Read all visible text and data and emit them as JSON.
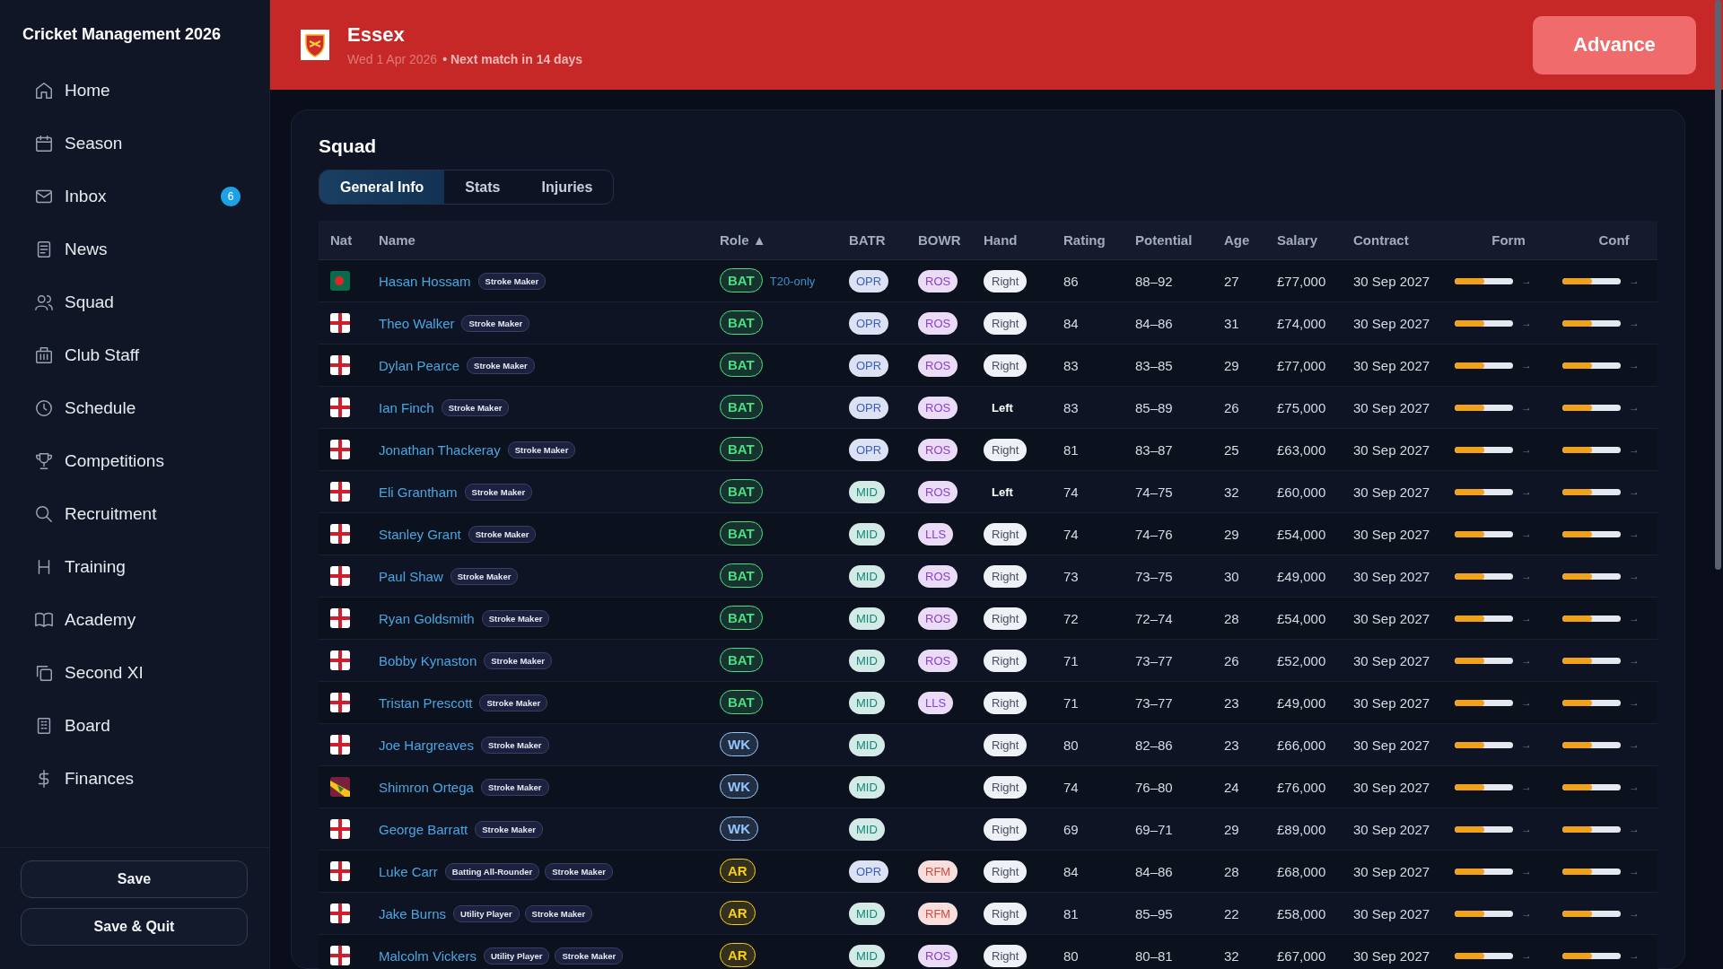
{
  "app_title": "Cricket Management 2026",
  "nav": [
    {
      "label": "Home"
    },
    {
      "label": "Season"
    },
    {
      "label": "Inbox",
      "badge": "6"
    },
    {
      "label": "News"
    },
    {
      "label": "Squad"
    },
    {
      "label": "Club Staff"
    },
    {
      "label": "Schedule"
    },
    {
      "label": "Competitions"
    },
    {
      "label": "Recruitment"
    },
    {
      "label": "Training"
    },
    {
      "label": "Academy"
    },
    {
      "label": "Second XI"
    },
    {
      "label": "Board"
    },
    {
      "label": "Finances"
    }
  ],
  "sidebar_buttons": [
    "Save",
    "Save & Quit"
  ],
  "header": {
    "club": "Essex",
    "date": "Wed 1 Apr 2026",
    "next_match": "• Next match in 14 days",
    "advance": "Advance"
  },
  "squad": {
    "title": "Squad",
    "tabs": [
      {
        "label": "General Info",
        "selected": true
      },
      {
        "label": "Stats",
        "selected": false
      },
      {
        "label": "Injuries",
        "selected": false
      }
    ],
    "columns": [
      "Nat",
      "Name",
      "Role ▲",
      "BATR",
      "BOWR",
      "Hand",
      "Rating",
      "Potential",
      "Age",
      "Salary",
      "Contract",
      "Form",
      "Conf"
    ],
    "rows": [
      {
        "nat": {
          "kind": "bd"
        },
        "name": "Hasan Hossam",
        "tags": [
          "Stroke Maker"
        ],
        "role": {
          "text": "BAT",
          "color": "#4ade80"
        },
        "note": "T20-only",
        "batr": {
          "text": "OPR",
          "color": "#3b5fc0"
        },
        "bowr": {
          "text": "ROS",
          "color": "#8b3fd0"
        },
        "hand": {
          "text": "Right",
          "boxed": true
        },
        "rating": "86",
        "potential": "88–92",
        "age": "27",
        "salary": "£77,000",
        "contract": "30 Sep 2027",
        "form": {
          "level": 0.5,
          "trend": "→"
        },
        "conf": {
          "level": 0.5,
          "trend": "→"
        }
      },
      {
        "nat": {
          "kind": "eng"
        },
        "name": "Theo Walker",
        "tags": [
          "Stroke Maker"
        ],
        "role": {
          "text": "BAT",
          "color": "#4ade80"
        },
        "batr": {
          "text": "OPR",
          "color": "#3b5fc0"
        },
        "bowr": {
          "text": "ROS",
          "color": "#8b3fd0"
        },
        "hand": {
          "text": "Right",
          "boxed": true
        },
        "rating": "84",
        "potential": "84–86",
        "age": "31",
        "salary": "£74,000",
        "contract": "30 Sep 2027",
        "form": {
          "level": 0.5,
          "trend": "→"
        },
        "conf": {
          "level": 0.5,
          "trend": "→"
        }
      },
      {
        "nat": {
          "kind": "eng"
        },
        "name": "Dylan Pearce",
        "tags": [
          "Stroke Maker"
        ],
        "role": {
          "text": "BAT",
          "color": "#4ade80"
        },
        "batr": {
          "text": "OPR",
          "color": "#3b5fc0"
        },
        "bowr": {
          "text": "ROS",
          "color": "#8b3fd0"
        },
        "hand": {
          "text": "Right",
          "boxed": true
        },
        "rating": "83",
        "potential": "83–85",
        "age": "29",
        "salary": "£77,000",
        "contract": "30 Sep 2027",
        "form": {
          "level": 0.5,
          "trend": "→"
        },
        "conf": {
          "level": 0.5,
          "trend": "→"
        }
      },
      {
        "nat": {
          "kind": "eng"
        },
        "name": "Ian Finch",
        "tags": [
          "Stroke Maker"
        ],
        "role": {
          "text": "BAT",
          "color": "#4ade80"
        },
        "batr": {
          "text": "OPR",
          "color": "#3b5fc0"
        },
        "bowr": {
          "text": "ROS",
          "color": "#8b3fd0"
        },
        "hand": {
          "text": "Left",
          "boxed": false
        },
        "rating": "83",
        "potential": "85–89",
        "age": "26",
        "salary": "£75,000",
        "contract": "30 Sep 2027",
        "form": {
          "level": 0.5,
          "trend": "→"
        },
        "conf": {
          "level": 0.5,
          "trend": "→"
        }
      },
      {
        "nat": {
          "kind": "eng"
        },
        "name": "Jonathan Thackeray",
        "tags": [
          "Stroke Maker"
        ],
        "role": {
          "text": "BAT",
          "color": "#4ade80"
        },
        "batr": {
          "text": "OPR",
          "color": "#3b5fc0"
        },
        "bowr": {
          "text": "ROS",
          "color": "#8b3fd0"
        },
        "hand": {
          "text": "Right",
          "boxed": true
        },
        "rating": "81",
        "potential": "83–87",
        "age": "25",
        "salary": "£63,000",
        "contract": "30 Sep 2027",
        "form": {
          "level": 0.5,
          "trend": "→"
        },
        "conf": {
          "level": 0.5,
          "trend": "→"
        }
      },
      {
        "nat": {
          "kind": "eng"
        },
        "name": "Eli Grantham",
        "tags": [
          "Stroke Maker"
        ],
        "role": {
          "text": "BAT",
          "color": "#4ade80"
        },
        "batr": {
          "text": "MID",
          "color": "#0f8a78"
        },
        "bowr": {
          "text": "ROS",
          "color": "#8b3fd0"
        },
        "hand": {
          "text": "Left",
          "boxed": false
        },
        "rating": "74",
        "potential": "74–75",
        "age": "32",
        "salary": "£60,000",
        "contract": "30 Sep 2027",
        "form": {
          "level": 0.5,
          "trend": "→"
        },
        "conf": {
          "level": 0.5,
          "trend": "→"
        }
      },
      {
        "nat": {
          "kind": "eng"
        },
        "name": "Stanley Grant",
        "tags": [
          "Stroke Maker"
        ],
        "role": {
          "text": "BAT",
          "color": "#4ade80"
        },
        "batr": {
          "text": "MID",
          "color": "#0f8a78"
        },
        "bowr": {
          "text": "LLS",
          "color": "#8b3fd0"
        },
        "hand": {
          "text": "Right",
          "boxed": true
        },
        "rating": "74",
        "potential": "74–76",
        "age": "29",
        "salary": "£54,000",
        "contract": "30 Sep 2027",
        "form": {
          "level": 0.5,
          "trend": "→"
        },
        "conf": {
          "level": 0.5,
          "trend": "→"
        }
      },
      {
        "nat": {
          "kind": "eng"
        },
        "name": "Paul Shaw",
        "tags": [
          "Stroke Maker"
        ],
        "role": {
          "text": "BAT",
          "color": "#4ade80"
        },
        "batr": {
          "text": "MID",
          "color": "#0f8a78"
        },
        "bowr": {
          "text": "ROS",
          "color": "#8b3fd0"
        },
        "hand": {
          "text": "Right",
          "boxed": true
        },
        "rating": "73",
        "potential": "73–75",
        "age": "30",
        "salary": "£49,000",
        "contract": "30 Sep 2027",
        "form": {
          "level": 0.5,
          "trend": "→"
        },
        "conf": {
          "level": 0.5,
          "trend": "→"
        }
      },
      {
        "nat": {
          "kind": "eng"
        },
        "name": "Ryan Goldsmith",
        "tags": [
          "Stroke Maker"
        ],
        "role": {
          "text": "BAT",
          "color": "#4ade80"
        },
        "batr": {
          "text": "MID",
          "color": "#0f8a78"
        },
        "bowr": {
          "text": "ROS",
          "color": "#8b3fd0"
        },
        "hand": {
          "text": "Right",
          "boxed": true
        },
        "rating": "72",
        "potential": "72–74",
        "age": "28",
        "salary": "£54,000",
        "contract": "30 Sep 2027",
        "form": {
          "level": 0.5,
          "trend": "→"
        },
        "conf": {
          "level": 0.5,
          "trend": "→"
        }
      },
      {
        "nat": {
          "kind": "eng"
        },
        "name": "Bobby Kynaston",
        "tags": [
          "Stroke Maker"
        ],
        "role": {
          "text": "BAT",
          "color": "#4ade80"
        },
        "batr": {
          "text": "MID",
          "color": "#0f8a78"
        },
        "bowr": {
          "text": "ROS",
          "color": "#8b3fd0"
        },
        "hand": {
          "text": "Right",
          "boxed": true
        },
        "rating": "71",
        "potential": "73–77",
        "age": "26",
        "salary": "£52,000",
        "contract": "30 Sep 2027",
        "form": {
          "level": 0.5,
          "trend": "→"
        },
        "conf": {
          "level": 0.5,
          "trend": "→"
        }
      },
      {
        "nat": {
          "kind": "eng"
        },
        "name": "Tristan Prescott",
        "tags": [
          "Stroke Maker"
        ],
        "role": {
          "text": "BAT",
          "color": "#4ade80"
        },
        "batr": {
          "text": "MID",
          "color": "#0f8a78"
        },
        "bowr": {
          "text": "LLS",
          "color": "#8b3fd0"
        },
        "hand": {
          "text": "Right",
          "boxed": true
        },
        "rating": "71",
        "potential": "73–77",
        "age": "23",
        "salary": "£49,000",
        "contract": "30 Sep 2027",
        "form": {
          "level": 0.5,
          "trend": "→"
        },
        "conf": {
          "level": 0.5,
          "trend": "→"
        }
      },
      {
        "nat": {
          "kind": "eng"
        },
        "name": "Joe Hargreaves",
        "tags": [
          "Stroke Maker"
        ],
        "role": {
          "text": "WK",
          "color": "#93c5fd"
        },
        "batr": {
          "text": "MID",
          "color": "#0f8a78"
        },
        "hand": {
          "text": "Right",
          "boxed": true
        },
        "rating": "80",
        "potential": "82–86",
        "age": "23",
        "salary": "£66,000",
        "contract": "30 Sep 2027",
        "form": {
          "level": 0.5,
          "trend": "→"
        },
        "conf": {
          "level": 0.5,
          "trend": "→"
        }
      },
      {
        "nat": {
          "kind": "wi"
        },
        "name": "Shimron Ortega",
        "tags": [
          "Stroke Maker"
        ],
        "role": {
          "text": "WK",
          "color": "#93c5fd"
        },
        "batr": {
          "text": "MID",
          "color": "#0f8a78"
        },
        "hand": {
          "text": "Right",
          "boxed": true
        },
        "rating": "74",
        "potential": "76–80",
        "age": "24",
        "salary": "£76,000",
        "contract": "30 Sep 2027",
        "form": {
          "level": 0.5,
          "trend": "→"
        },
        "conf": {
          "level": 0.5,
          "trend": "→"
        }
      },
      {
        "nat": {
          "kind": "eng"
        },
        "name": "George Barratt",
        "tags": [
          "Stroke Maker"
        ],
        "role": {
          "text": "WK",
          "color": "#93c5fd"
        },
        "batr": {
          "text": "MID",
          "color": "#0f8a78"
        },
        "hand": {
          "text": "Right",
          "boxed": true
        },
        "rating": "69",
        "potential": "69–71",
        "age": "29",
        "salary": "£89,000",
        "contract": "30 Sep 2027",
        "form": {
          "level": 0.5,
          "trend": "→"
        },
        "conf": {
          "level": 0.5,
          "trend": "→"
        }
      },
      {
        "nat": {
          "kind": "eng"
        },
        "name": "Luke Carr",
        "tags": [
          "Batting All-Rounder",
          "Stroke Maker"
        ],
        "role": {
          "text": "AR",
          "color": "#facc15"
        },
        "batr": {
          "text": "OPR",
          "color": "#3b5fc0"
        },
        "bowr": {
          "text": "RFM",
          "color": "#d9483f"
        },
        "hand": {
          "text": "Right",
          "boxed": true
        },
        "rating": "84",
        "potential": "84–86",
        "age": "28",
        "salary": "£68,000",
        "contract": "30 Sep 2027",
        "form": {
          "level": 0.5,
          "trend": "→"
        },
        "conf": {
          "level": 0.5,
          "trend": "→"
        }
      },
      {
        "nat": {
          "kind": "eng"
        },
        "name": "Jake Burns",
        "tags": [
          "Utility Player",
          "Stroke Maker"
        ],
        "role": {
          "text": "AR",
          "color": "#facc15"
        },
        "batr": {
          "text": "MID",
          "color": "#0f8a78"
        },
        "bowr": {
          "text": "RFM",
          "color": "#d9483f"
        },
        "hand": {
          "text": "Right",
          "boxed": true
        },
        "rating": "81",
        "potential": "85–95",
        "age": "22",
        "salary": "£58,000",
        "contract": "30 Sep 2027",
        "form": {
          "level": 0.5,
          "trend": "→"
        },
        "conf": {
          "level": 0.5,
          "trend": "→"
        }
      },
      {
        "nat": {
          "kind": "eng"
        },
        "name": "Malcolm Vickers",
        "tags": [
          "Utility Player",
          "Stroke Maker"
        ],
        "role": {
          "text": "AR",
          "color": "#facc15"
        },
        "batr": {
          "text": "MID",
          "color": "#0f8a78"
        },
        "bowr": {
          "text": "ROS",
          "color": "#8b3fd0"
        },
        "hand": {
          "text": "Right",
          "boxed": true
        },
        "rating": "80",
        "potential": "80–81",
        "age": "32",
        "salary": "£67,000",
        "contract": "30 Sep 2027",
        "form": {
          "level": 0.5,
          "trend": "→"
        },
        "conf": {
          "level": 0.5,
          "trend": "→"
        }
      }
    ]
  }
}
